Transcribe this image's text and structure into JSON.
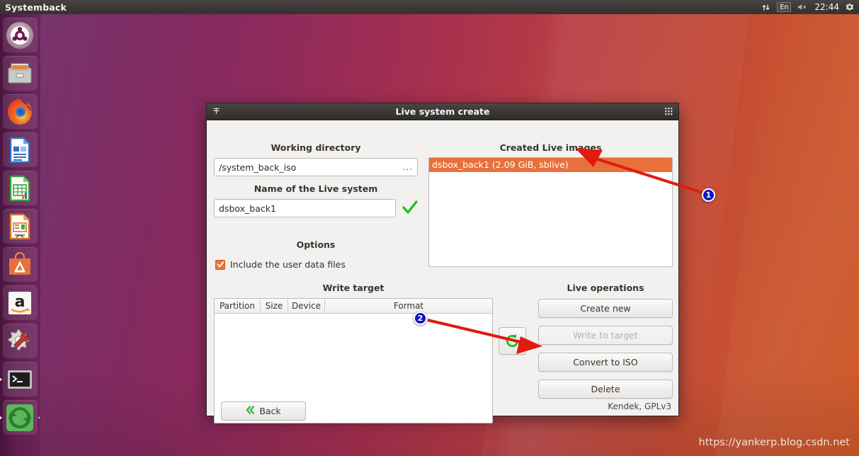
{
  "top_panel": {
    "app_title": "Systemback",
    "tray": {
      "network_icon": "network-updown-icon",
      "keyboard_layout": "En",
      "volume_icon": "volume-muted-icon",
      "clock": "22:44",
      "settings_icon": "gear-icon"
    }
  },
  "launcher": {
    "items": [
      {
        "name": "ubuntu-dash",
        "label": "Dash home",
        "icon": "ubuntu-logo-icon",
        "running": false
      },
      {
        "name": "files",
        "label": "Files",
        "icon": "file-cabinet-icon",
        "running": false
      },
      {
        "name": "firefox",
        "label": "Firefox Web Browser",
        "icon": "firefox-icon",
        "running": false
      },
      {
        "name": "libreoffice-writer",
        "label": "LibreOffice Writer",
        "icon": "writer-document-icon",
        "running": false
      },
      {
        "name": "libreoffice-calc",
        "label": "LibreOffice Calc",
        "icon": "calc-spreadsheet-icon",
        "running": false
      },
      {
        "name": "libreoffice-impress",
        "label": "LibreOffice Impress",
        "icon": "impress-presentation-icon",
        "running": false
      },
      {
        "name": "ubuntu-software",
        "label": "Ubuntu Software",
        "icon": "software-bag-icon",
        "running": false
      },
      {
        "name": "amazon",
        "label": "Amazon",
        "icon": "amazon-icon",
        "running": false
      },
      {
        "name": "system-settings",
        "label": "System Settings",
        "icon": "gear-wrench-icon",
        "running": false
      },
      {
        "name": "terminal",
        "label": "Terminal",
        "icon": "terminal-icon",
        "running": false
      },
      {
        "name": "systemback",
        "label": "Systemback",
        "icon": "systemback-recycle-icon",
        "running": true
      }
    ]
  },
  "window": {
    "title": "Live system create",
    "titlebar_left_icon": "menu-pin-icon",
    "titlebar_grip_icon": "resize-grip-icon",
    "working_directory": {
      "label": "Working directory",
      "value": "/system_back_iso",
      "browse_button": "..."
    },
    "live_system_name": {
      "label": "Name of the Live system",
      "value": "dsbox_back1",
      "valid_icon": "green-check-icon"
    },
    "options": {
      "label": "Options",
      "include_user_data": {
        "label": "Include the user data files",
        "checked": true
      }
    },
    "write_target": {
      "label": "Write target",
      "columns": [
        "Partition",
        "Size",
        "Device",
        "Format"
      ],
      "rows": []
    },
    "created_live_images": {
      "label": "Created Live images",
      "items": [
        {
          "text": "dsbox_back1 (2.09 GiB, sblive)",
          "selected": true
        }
      ]
    },
    "live_operations": {
      "label": "Live operations",
      "refresh_button": "refresh-icon",
      "buttons": [
        {
          "label": "Create new",
          "enabled": true
        },
        {
          "label": "Write to target",
          "enabled": false
        },
        {
          "label": "Convert to ISO",
          "enabled": true
        },
        {
          "label": "Delete",
          "enabled": true
        }
      ]
    },
    "back_button": {
      "label": "Back",
      "icon": "double-chevron-left-icon"
    },
    "credit": "Kendek, GPLv3"
  },
  "annotations": {
    "color": "#e01b10",
    "badges": [
      {
        "number": "1",
        "target": "created-live-images-selected-item"
      },
      {
        "number": "2",
        "target": "convert-to-iso-button"
      }
    ]
  },
  "watermark": "https://yankerp.blog.csdn.net"
}
